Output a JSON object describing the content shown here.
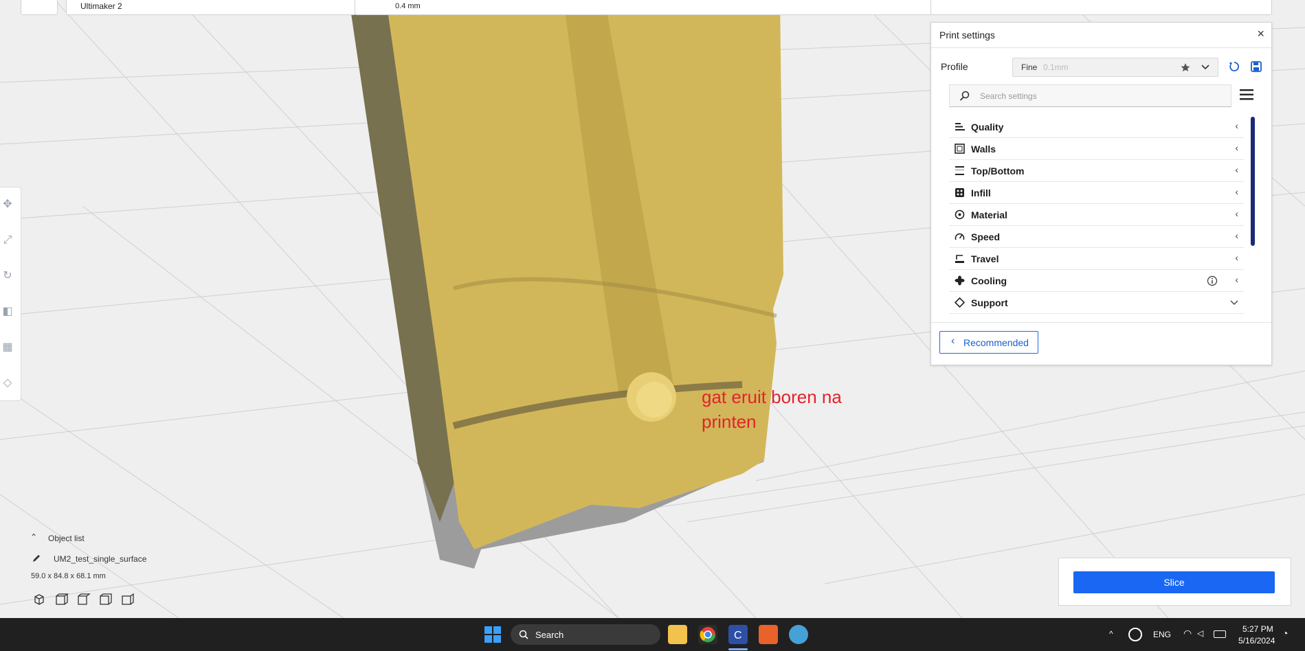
{
  "topbar": {
    "printer_name": "Ultimaker 2",
    "nozzle_size": "0.4 mm"
  },
  "print_settings": {
    "title": "Print settings",
    "profile_label": "Profile",
    "profile_name": "Fine",
    "profile_layer_height": "0.1mm",
    "search_placeholder": "Search settings",
    "categories": [
      {
        "label": "Quality",
        "icon": "quality-icon",
        "state": "collapsed"
      },
      {
        "label": "Walls",
        "icon": "walls-icon",
        "state": "collapsed"
      },
      {
        "label": "Top/Bottom",
        "icon": "top-bottom-icon",
        "state": "collapsed"
      },
      {
        "label": "Infill",
        "icon": "infill-icon",
        "state": "collapsed"
      },
      {
        "label": "Material",
        "icon": "material-icon",
        "state": "collapsed"
      },
      {
        "label": "Speed",
        "icon": "speed-icon",
        "state": "collapsed"
      },
      {
        "label": "Travel",
        "icon": "travel-icon",
        "state": "collapsed"
      },
      {
        "label": "Cooling",
        "icon": "cooling-icon",
        "state": "collapsed"
      },
      {
        "label": "Support",
        "icon": "support-icon",
        "state": "expanded"
      }
    ],
    "recommended_button": "Recommended"
  },
  "object_list": {
    "header": "Object list",
    "object_name": "UM2_test_single_surface",
    "dimensions": "59.0 x 84.8 x 68.1 mm"
  },
  "slice_panel": {
    "slice_button": "Slice"
  },
  "annotation": {
    "text": "gat eruit boren na printen",
    "color": "#e4222b"
  },
  "colors": {
    "accent": "#1967f2",
    "model": "#e4c766",
    "taskbar": "#202020"
  },
  "taskbar": {
    "search_label": "Search",
    "language": "ENG",
    "time": "5:27 PM",
    "date": "5/16/2024"
  }
}
